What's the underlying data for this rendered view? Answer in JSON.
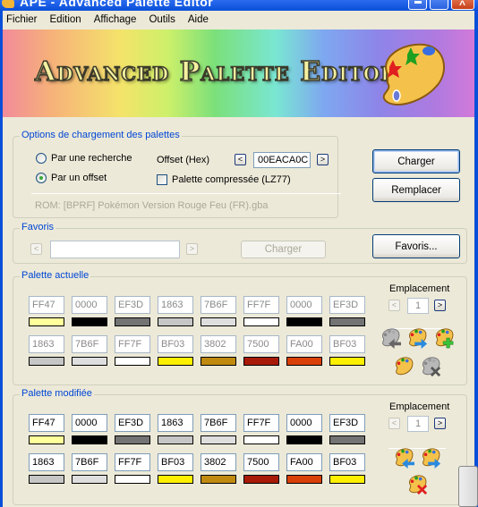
{
  "window": {
    "title": "APE - Advanced Palette Editor",
    "controls": {
      "minimize": "minimize",
      "maximize": "maximize",
      "close": "close"
    }
  },
  "menu": [
    "Fichier",
    "Edition",
    "Affichage",
    "Outils",
    "Aide"
  ],
  "banner": {
    "title": "Advanced Palette Editor"
  },
  "load_options": {
    "group_label": "Options de chargement des palettes",
    "radio_search": "Par une recherche",
    "radio_offset": "Par un offset",
    "selected": "offset",
    "offset_label": "Offset (Hex)",
    "offset_value": "00EACA0C",
    "compressed_label": "Palette compressée (LZ77)",
    "compressed_checked": false,
    "rom_text": "ROM: [BPRF] Pokémon Version Rouge Feu (FR).gba",
    "prev": "<",
    "next": ">"
  },
  "actions": {
    "charger": "Charger",
    "remplacer": "Remplacer",
    "favoris": "Favoris..."
  },
  "favoris": {
    "group_label": "Favoris",
    "value": "",
    "charger": "Charger",
    "prev": "<",
    "next": ">"
  },
  "current_palette": {
    "group_label": "Palette actuelle",
    "emplacement_label": "Emplacement",
    "emplacement_value": "1",
    "prev": "<",
    "next": ">",
    "colors": [
      {
        "hex": "FF47",
        "rgb": "#ffff9c"
      },
      {
        "hex": "0000",
        "rgb": "#000000"
      },
      {
        "hex": "EF3D",
        "rgb": "#737373"
      },
      {
        "hex": "1863",
        "rgb": "#c6c6c6"
      },
      {
        "hex": "7B6F",
        "rgb": "#dedede"
      },
      {
        "hex": "FF7F",
        "rgb": "#ffffff"
      },
      {
        "hex": "0000",
        "rgb": "#000000"
      },
      {
        "hex": "EF3D",
        "rgb": "#737373"
      },
      {
        "hex": "1863",
        "rgb": "#c6c6c6"
      },
      {
        "hex": "7B6F",
        "rgb": "#dedede"
      },
      {
        "hex": "FF7F",
        "rgb": "#ffffff"
      },
      {
        "hex": "BF03",
        "rgb": "#fff000"
      },
      {
        "hex": "3802",
        "rgb": "#c08a10"
      },
      {
        "hex": "7500",
        "rgb": "#a81a08"
      },
      {
        "hex": "FA00",
        "rgb": "#d84008"
      },
      {
        "hex": "BF03",
        "rgb": "#fff000"
      }
    ],
    "tools": [
      "import-palette-icon",
      "export-palette-icon",
      "add-palette-icon",
      "palette-icon",
      "delete-palette-icon"
    ]
  },
  "modified_palette": {
    "group_label": "Palette modifiée",
    "emplacement_label": "Emplacement",
    "emplacement_value": "1",
    "prev": "<",
    "next": ">",
    "colors": [
      {
        "hex": "FF47",
        "rgb": "#ffff9c"
      },
      {
        "hex": "0000",
        "rgb": "#000000"
      },
      {
        "hex": "EF3D",
        "rgb": "#737373"
      },
      {
        "hex": "1863",
        "rgb": "#c6c6c6"
      },
      {
        "hex": "7B6F",
        "rgb": "#dedede"
      },
      {
        "hex": "FF7F",
        "rgb": "#ffffff"
      },
      {
        "hex": "0000",
        "rgb": "#000000"
      },
      {
        "hex": "EF3D",
        "rgb": "#737373"
      },
      {
        "hex": "1863",
        "rgb": "#c6c6c6"
      },
      {
        "hex": "7B6F",
        "rgb": "#dedede"
      },
      {
        "hex": "FF7F",
        "rgb": "#ffffff"
      },
      {
        "hex": "BF03",
        "rgb": "#fff000"
      },
      {
        "hex": "3802",
        "rgb": "#c08a10"
      },
      {
        "hex": "7500",
        "rgb": "#a81a08"
      },
      {
        "hex": "FA00",
        "rgb": "#d84008"
      },
      {
        "hex": "BF03",
        "rgb": "#fff000"
      }
    ],
    "tools": [
      "import-palette-icon",
      "export-palette-icon",
      "delete-palette-icon"
    ]
  }
}
